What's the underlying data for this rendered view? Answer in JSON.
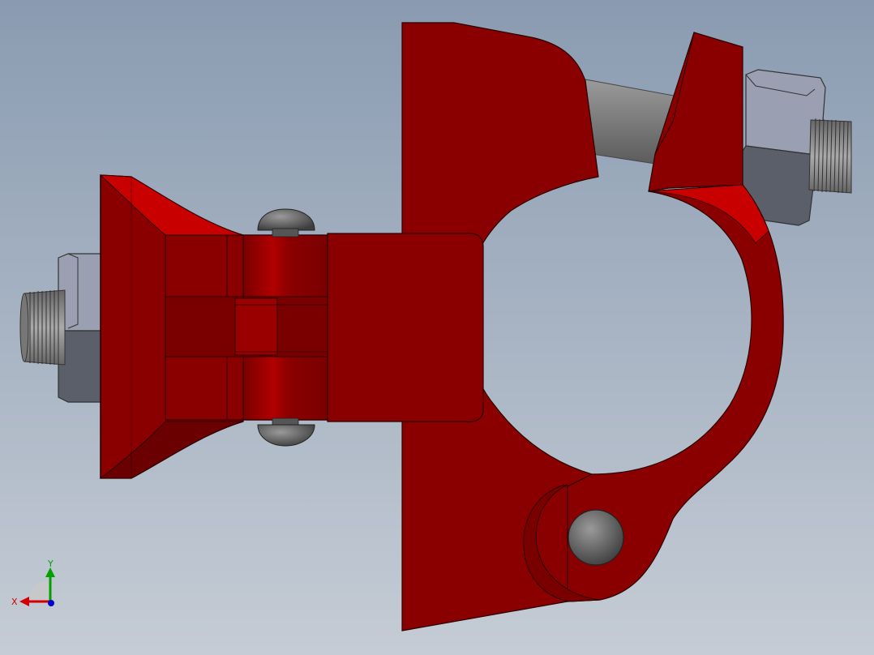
{
  "viewport": {
    "background_top": "#8a9bb1",
    "background_bottom": "#c5ccd5"
  },
  "colors": {
    "part_red": "#8a0000",
    "part_red_light": "#c80000",
    "part_red_dark": "#6a0000",
    "bolt_gray": "#7a7a7a",
    "bolt_gray_light": "#a0a0a0",
    "nut_gray": "#7d8190",
    "nut_gray_light": "#9aa0b2",
    "fastener_dark": "#555555"
  },
  "triad": {
    "x_label": "X",
    "y_label": "Y",
    "x_color": "#d40000",
    "y_color": "#00a000",
    "z_color": "#0000d0"
  }
}
